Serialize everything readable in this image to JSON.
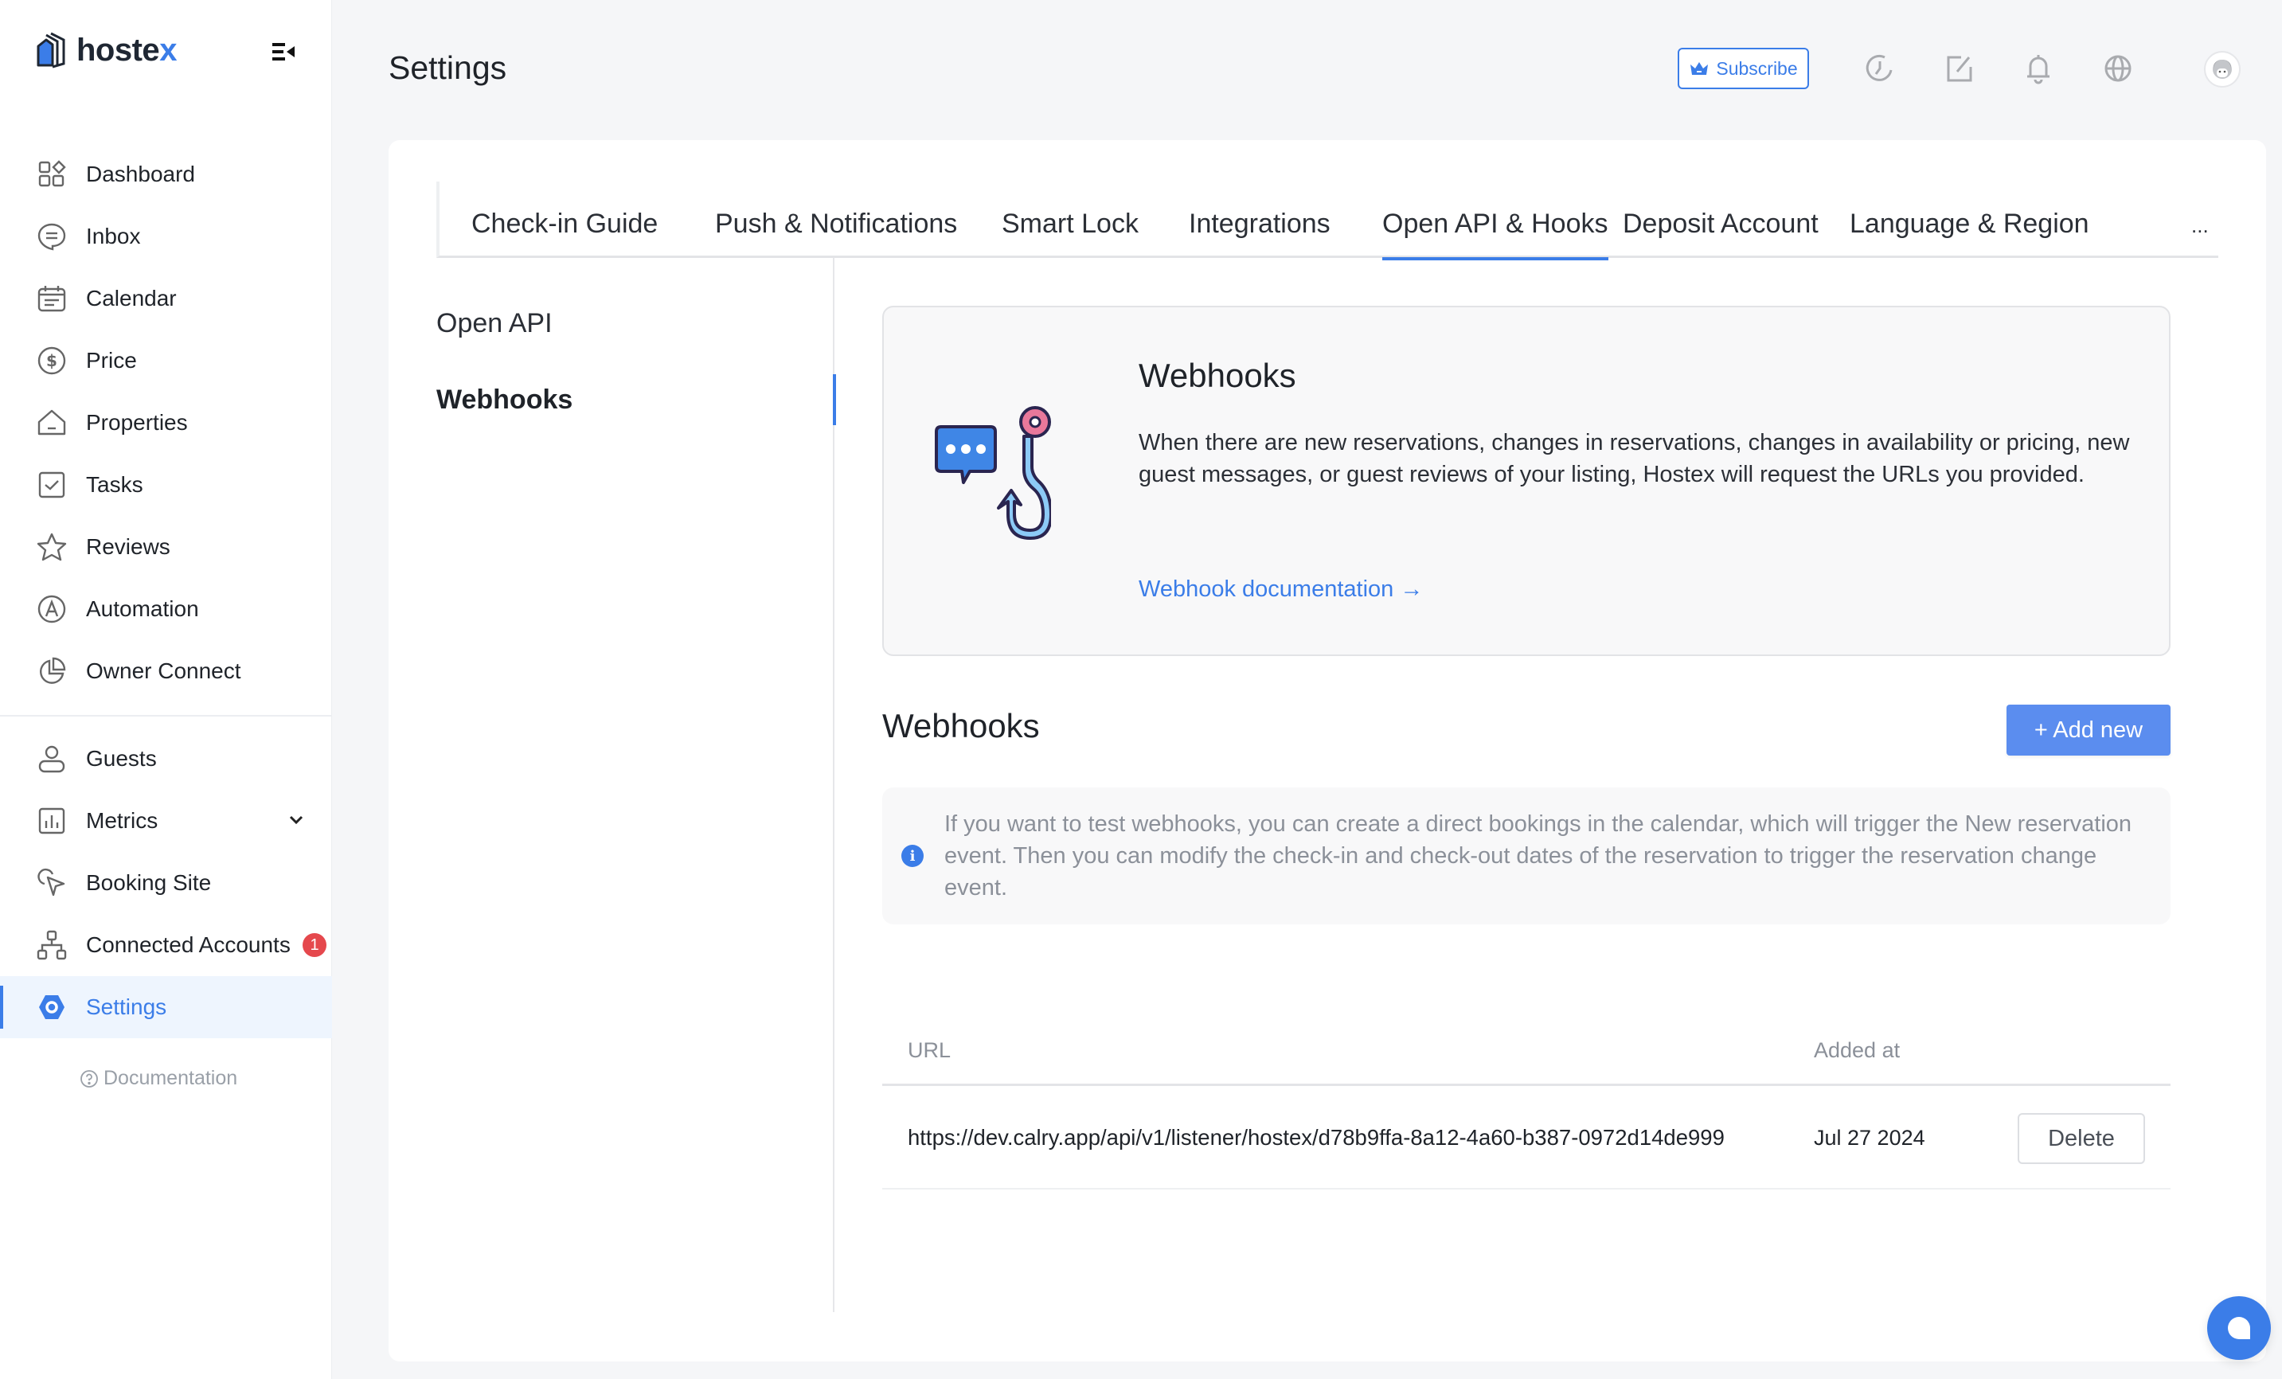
{
  "brand": {
    "name_main": "hoste",
    "name_accent": "x"
  },
  "header": {
    "title": "Settings",
    "subscribe_label": "Subscribe",
    "icons": [
      "history-icon",
      "edit-icon",
      "bell-icon",
      "globe-icon",
      "avatar"
    ]
  },
  "sidebar": {
    "items": [
      {
        "label": "Dashboard",
        "icon": "dashboard-icon"
      },
      {
        "label": "Inbox",
        "icon": "inbox-icon"
      },
      {
        "label": "Calendar",
        "icon": "calendar-icon"
      },
      {
        "label": "Price",
        "icon": "dollar-icon"
      },
      {
        "label": "Properties",
        "icon": "home-icon"
      },
      {
        "label": "Tasks",
        "icon": "check-square-icon"
      },
      {
        "label": "Reviews",
        "icon": "star-icon"
      },
      {
        "label": "Automation",
        "icon": "automation-icon"
      },
      {
        "label": "Owner Connect",
        "icon": "pie-chart-icon"
      }
    ],
    "items2": [
      {
        "label": "Guests",
        "icon": "user-icon"
      },
      {
        "label": "Metrics",
        "icon": "bar-chart-icon",
        "expandable": true
      },
      {
        "label": "Booking Site",
        "icon": "pointer-icon"
      },
      {
        "label": "Connected Accounts",
        "icon": "network-icon",
        "badge": "1"
      },
      {
        "label": "Settings",
        "icon": "settings-icon",
        "active": true
      }
    ],
    "documentation_label": "Documentation"
  },
  "tabs": {
    "items": [
      "Check-in Guide",
      "Push & Notifications",
      "Smart Lock",
      "Integrations",
      "Open API & Hooks",
      "Deposit Account",
      "Language & Region"
    ],
    "active": "Open API & Hooks",
    "more_label": "..."
  },
  "subnav": {
    "items": [
      "Open API",
      "Webhooks"
    ],
    "active": "Webhooks"
  },
  "intro": {
    "title": "Webhooks",
    "description": "When there are new reservations, changes in reservations, changes in availability or pricing, new guest messages, or guest reviews of your listing, Hostex will request the URLs you provided.",
    "link_label": "Webhook documentation →"
  },
  "webhooks": {
    "title": "Webhooks",
    "add_label": "+ Add new",
    "notice": "If you want to test webhooks, you can create a direct bookings in the calendar, which will trigger the New reservation event. Then you can modify the check-in and check-out dates of the reservation to trigger the reservation change event.",
    "columns": [
      "URL",
      "Added at"
    ],
    "rows": [
      {
        "url": "https://dev.calry.app/api/v1/listener/hostex/d78b9ffa-8a12-4a60-b387-0972d14de999",
        "added_at": "Jul 27 2024",
        "action": "Delete"
      }
    ]
  },
  "colors": {
    "accent": "#3b7de8",
    "badge": "#e5484d",
    "add_button": "#5b8def"
  }
}
